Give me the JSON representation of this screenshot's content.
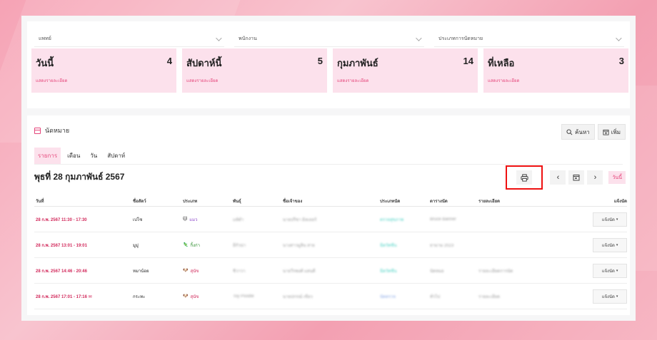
{
  "filters": [
    {
      "name": "filter-vet",
      "value": "แพทย์"
    },
    {
      "name": "filter-staff",
      "value": "พนักงาน"
    },
    {
      "name": "filter-type",
      "value": "ประเภทการนัดหมาย"
    }
  ],
  "cards": [
    {
      "title": "วันนี้",
      "count": "4",
      "link": "แสดงรายละเอียด"
    },
    {
      "title": "สัปดาห์นี้",
      "count": "5",
      "link": "แสดงรายละเอียด"
    },
    {
      "title": "กุมภาพันธ์",
      "count": "14",
      "link": "แสดงรายละเอียด"
    },
    {
      "title": "ที่เหลือ",
      "count": "3",
      "link": "แสดงรายละเอียด"
    }
  ],
  "appointments": {
    "heading": "นัดหมาย",
    "search_label": "ค้นหา",
    "add_label": "เพิ่ม",
    "tabs": [
      "รายการ",
      "เดือน",
      "วัน",
      "สัปดาห์"
    ],
    "date_title": "พุธที่ 28 กุมภาพันธ์ 2567",
    "today_label": "วันนี้",
    "columns": [
      "วันที่",
      "ชื่อสัตว์",
      "ประเภท",
      "พันธุ์",
      "ชื่อเจ้าของ",
      "ประเภทนัด",
      "ตารางนัด",
      "รายละเอียด",
      "แจ้งนัด"
    ],
    "rows": [
      {
        "time": "28 ก.พ. 2567 11:30 - 17:30",
        "pet": "เปโซ",
        "type_icon": "🐱",
        "type": "แมว",
        "type_color": "purple",
        "breed": "แท้ดำ",
        "owner": "นายปรีชา มิลเลอร์",
        "appt_type": "ตรวจสุขภาพ",
        "schedule": "Bruce Banner",
        "detail": "",
        "notify": "แจ้งนัด"
      },
      {
        "time": "28 ก.พ. 2567 13:01 - 19:01",
        "pet": "มูมู่",
        "type_icon": "🦎",
        "type": "กิ้งก่า",
        "type_color": "green",
        "breed": "อีกัวน่า",
        "owner": "นางสาวมูลิน สาย",
        "appt_type": "ฉีดวัคซีน",
        "schedule": "ยามาม 2023",
        "detail": "",
        "notify": "แจ้งนัด"
      },
      {
        "time": "28 ก.พ. 2567 14:46 - 20:46",
        "pet": "หมาน้อย",
        "type_icon": "🐶",
        "type": "สุนัข",
        "type_color": "red",
        "breed": "ชิวาวา",
        "owner": "นายวีรพงศ์ แสนดี",
        "appt_type": "ฉีดวัคซีน",
        "schedule": "นัดหมอ",
        "detail": "รายละเอียดการนัด",
        "notify": "แจ้งนัด"
      },
      {
        "time": "28 ก.พ. 2567 17:01 - 17:16",
        "pet": "กระทะ",
        "type_icon": "🐶",
        "type": "สุนัข",
        "type_color": "red",
        "breed": "Toy Poodle",
        "owner": "นายปกรณ์ เขียว",
        "appt_type": "นัดตรวจ",
        "schedule": "ทั่วไป",
        "detail": "รายละเอียด",
        "notify": "แจ้งนัด"
      }
    ]
  }
}
